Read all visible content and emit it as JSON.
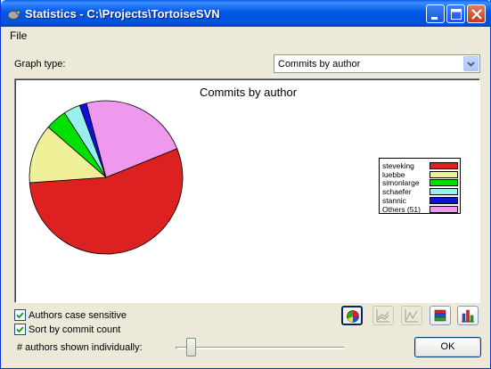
{
  "window": {
    "title": "Statistics - C:\\Projects\\TortoiseSVN"
  },
  "menu": {
    "items": [
      "File"
    ]
  },
  "graph_type": {
    "label": "Graph type:",
    "selected": "Commits by author"
  },
  "chart_data": {
    "type": "pie",
    "title": "Commits by author",
    "legend_position": "right",
    "slices": [
      {
        "label": "steveking",
        "value": 55.0,
        "color": "#DD2020"
      },
      {
        "label": "luebbe",
        "value": 12.5,
        "color": "#F0F099"
      },
      {
        "label": "simonlarge",
        "value": 4.5,
        "color": "#00E000"
      },
      {
        "label": "schaefer",
        "value": 3.5,
        "color": "#99EEEE"
      },
      {
        "label": "stannic",
        "value": 1.5,
        "color": "#1010DD"
      },
      {
        "label": "Others (51)",
        "value": 23.0,
        "color": "#EE99EE"
      }
    ]
  },
  "options": {
    "case_sensitive": {
      "label": "Authors case sensitive",
      "checked": true
    },
    "sort_by_count": {
      "label": "Sort by commit count",
      "checked": true
    }
  },
  "slider": {
    "label": "# authors shown individually:",
    "position_fraction": 0.09
  },
  "chart_buttons": [
    {
      "name": "pie-chart",
      "state": "active"
    },
    {
      "name": "stacked-line-chart",
      "state": "disabled"
    },
    {
      "name": "line-chart",
      "state": "disabled"
    },
    {
      "name": "stacked-bar-chart",
      "state": "normal"
    },
    {
      "name": "bar-chart",
      "state": "normal"
    }
  ],
  "ok_label": "OK"
}
